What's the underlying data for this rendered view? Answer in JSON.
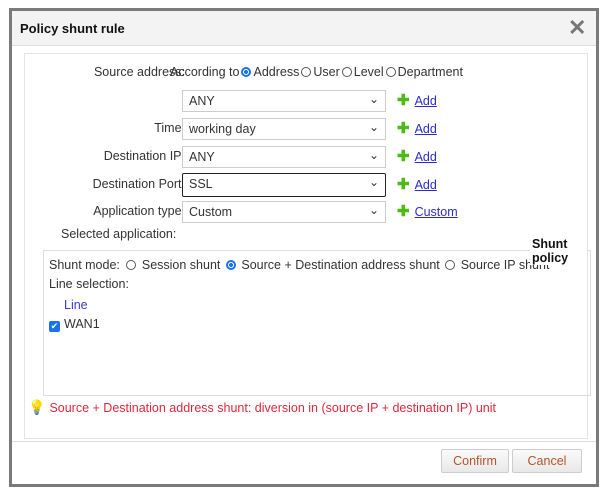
{
  "dialog": {
    "title": "Policy shunt rule"
  },
  "form": {
    "source_label": "Source address:",
    "according_to": "According to",
    "source_options": [
      {
        "label": "Address",
        "checked": true
      },
      {
        "label": "User",
        "checked": false
      },
      {
        "label": "Level",
        "checked": false
      },
      {
        "label": "Department",
        "checked": false
      }
    ],
    "source_value": "ANY",
    "add": "Add",
    "time_label": "Time:",
    "time_value": "working day",
    "dest_ip_label": "Destination IP:",
    "dest_ip_value": "ANY",
    "dest_port_label": "Destination Port:",
    "dest_port_value": "SSL",
    "app_type_label": "Application type:",
    "app_type_value": "Custom",
    "custom_link": "Custom",
    "selected_app_label": "Selected application:"
  },
  "shunt": {
    "legend": "Shunt policy",
    "mode_label": "Shunt mode:",
    "modes": [
      {
        "label": "Session shunt",
        "checked": false
      },
      {
        "label": "Source + Destination address shunt",
        "checked": true
      },
      {
        "label": "Source IP shunt",
        "checked": false
      }
    ],
    "line_selection_label": "Line selection:",
    "line_header": "Line",
    "lines": [
      {
        "label": "WAN1",
        "checked": true
      }
    ]
  },
  "hint": "Source + Destination address shunt: diversion in (source IP + destination IP) unit",
  "buttons": {
    "confirm": "Confirm",
    "cancel": "Cancel"
  }
}
